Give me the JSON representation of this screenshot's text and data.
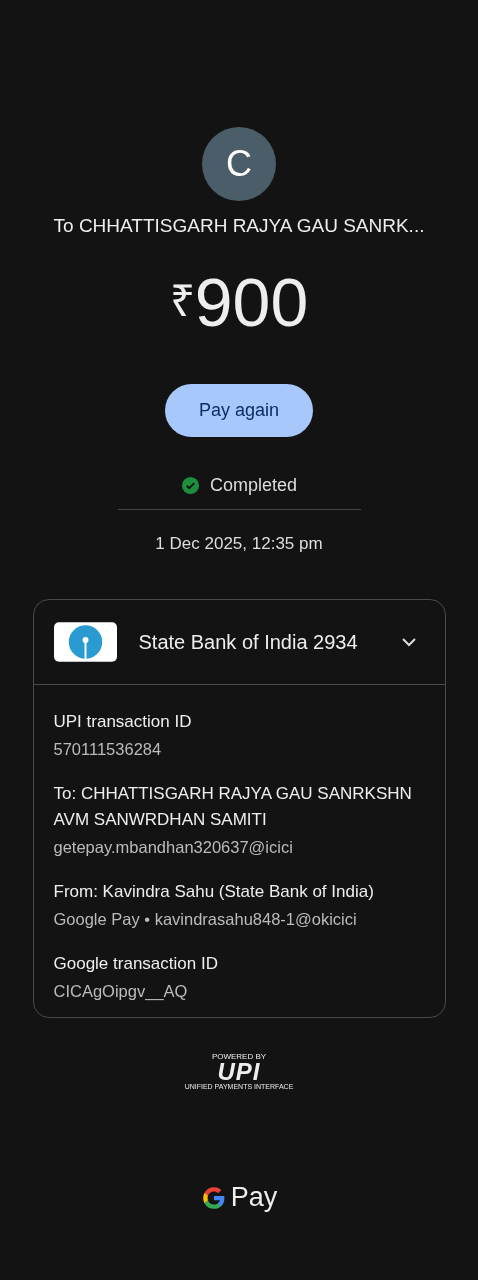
{
  "avatar": {
    "initial": "C"
  },
  "recipient_title": "To CHHATTISGARH RAJYA GAU SANRK...",
  "amount": {
    "currency": "₹",
    "value": "900"
  },
  "pay_again_button": "Pay again",
  "status": {
    "label": "Completed",
    "completed": true
  },
  "datetime": "1 Dec 2025, 12:35 pm",
  "details_card": {
    "account": "State Bank of India 2934",
    "expanded": true,
    "fields": [
      {
        "label": "UPI transaction ID",
        "values": [
          "570111536284"
        ]
      },
      {
        "label": "To: CHHATTISGARH RAJYA GAU SANRKSHN AVM SANWRDHAN SAMITI",
        "values": [
          "getepay.mbandhan320637@icici"
        ]
      },
      {
        "label": "From: Kavindra  Sahu (State Bank of India)",
        "values": [
          "Google Pay • kavindrasahu848-1@okicici"
        ]
      },
      {
        "label": "Google transaction ID",
        "values": [
          "CICAgOipgv__AQ"
        ]
      }
    ]
  },
  "upi_badge": {
    "powered_by": "POWERED BY",
    "logo": "UPI",
    "tagline": "UNIFIED PAYMENTS INTERFACE"
  },
  "footer_brand": {
    "name": "Pay"
  }
}
